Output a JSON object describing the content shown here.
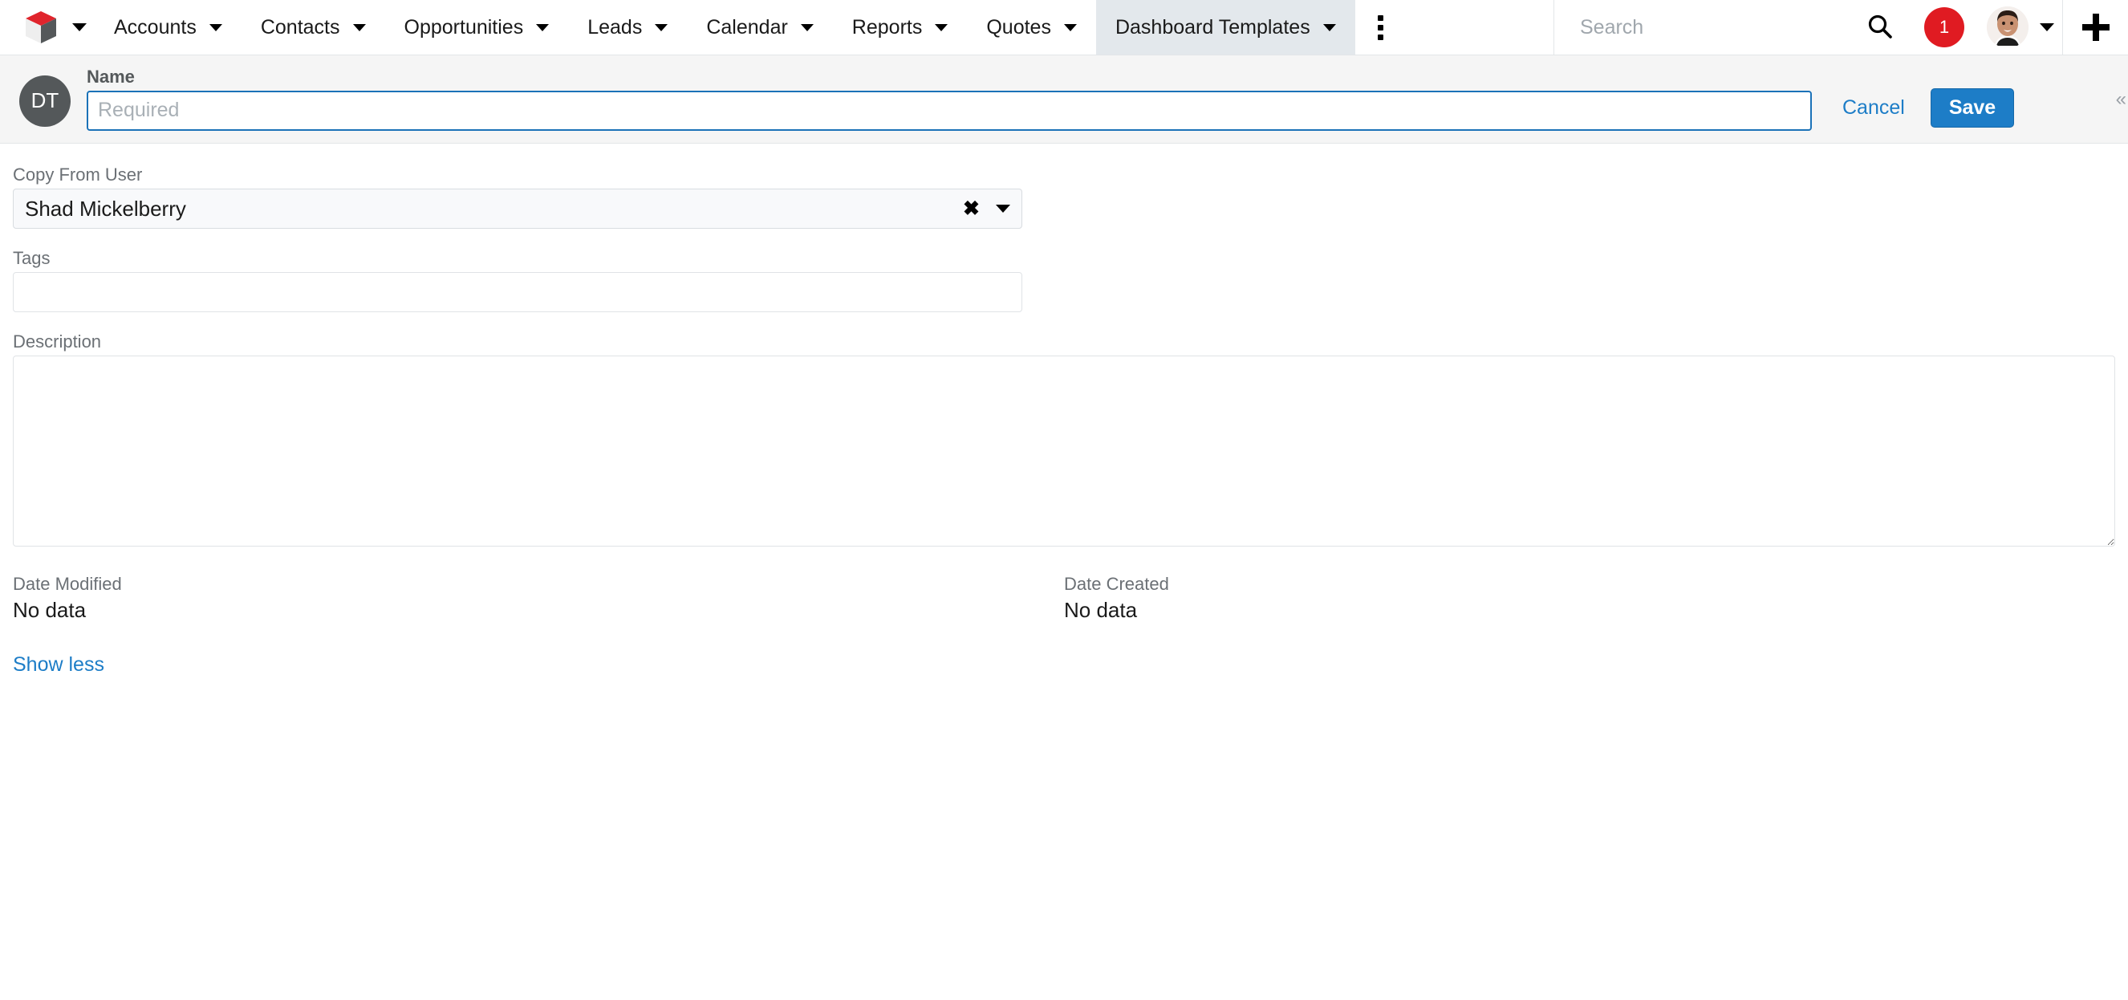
{
  "navbar": {
    "logo_icon": "sugar-cube-logo",
    "logo_caret_icon": "chevron-down-icon",
    "tabs": [
      {
        "label": "Accounts",
        "active": false
      },
      {
        "label": "Contacts",
        "active": false
      },
      {
        "label": "Opportunities",
        "active": false
      },
      {
        "label": "Leads",
        "active": false
      },
      {
        "label": "Calendar",
        "active": false
      },
      {
        "label": "Reports",
        "active": false
      },
      {
        "label": "Quotes",
        "active": false
      },
      {
        "label": "Dashboard Templates",
        "active": true
      }
    ],
    "more_menu_icon": "kebab-menu-icon",
    "search": {
      "placeholder": "Search",
      "value": "",
      "icon": "search-icon"
    },
    "notifications": {
      "count": "1",
      "color": "#e01b22"
    },
    "avatar": {
      "icon": "user-avatar-photo",
      "caret_icon": "chevron-down-icon"
    },
    "quick_create_icon": "plus-icon"
  },
  "record_header": {
    "avatar_initials": "DT",
    "avatar_color": "#54585a",
    "name": {
      "label": "Name",
      "value": "",
      "placeholder": "Required",
      "focus_color": "#1b72b8"
    },
    "cancel_label": "Cancel",
    "save_label": "Save",
    "save_color": "#1d7dc7",
    "collapse_icon": "chevron-double-left-icon",
    "collapse_glyph": "«"
  },
  "form": {
    "copy_from_user": {
      "label": "Copy From User",
      "value": "Shad Mickelberry",
      "clear_glyph": "✖",
      "clear_icon": "clear-selection-icon",
      "caret_icon": "chevron-down-icon"
    },
    "tags": {
      "label": "Tags",
      "value": "",
      "placeholder": ""
    },
    "description": {
      "label": "Description",
      "value": "",
      "placeholder": ""
    },
    "date_modified": {
      "label": "Date Modified",
      "value": "No data"
    },
    "date_created": {
      "label": "Date Created",
      "value": "No data"
    },
    "show_less_label": "Show less"
  }
}
